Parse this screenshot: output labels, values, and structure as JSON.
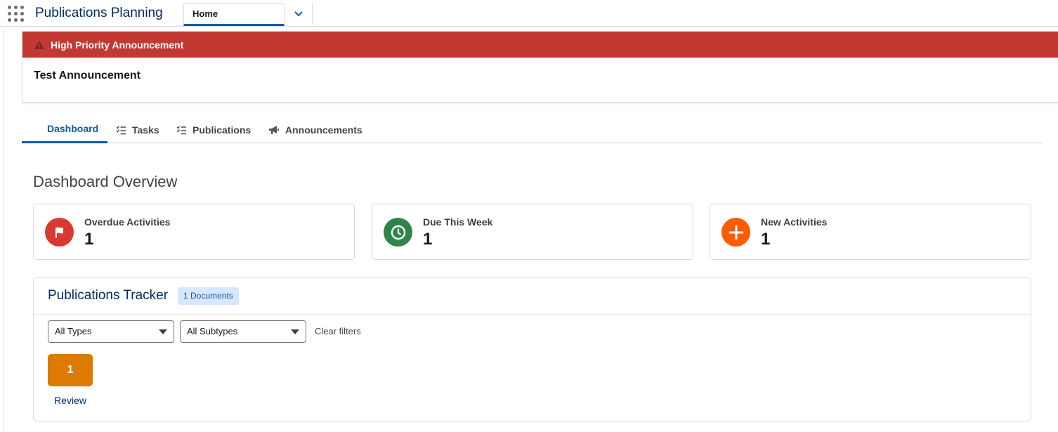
{
  "app": {
    "name": "Publications Planning",
    "nav_tab": "Home"
  },
  "announcement": {
    "title": "High Priority Announcement",
    "body": "Test Announcement",
    "header_color": "#c23934"
  },
  "tabs": [
    {
      "label": "Dashboard",
      "icon": "none",
      "active": true
    },
    {
      "label": "Tasks",
      "icon": "task-list-icon",
      "active": false
    },
    {
      "label": "Publications",
      "icon": "task-list-icon",
      "active": false
    },
    {
      "label": "Announcements",
      "icon": "megaphone-icon",
      "active": false
    }
  ],
  "overview": {
    "title": "Dashboard Overview",
    "cards": [
      {
        "label": "Overdue Activities",
        "value": "1",
        "icon": "flag-icon",
        "color": "#d93930"
      },
      {
        "label": "Due This Week",
        "value": "1",
        "icon": "clock-icon",
        "color": "#2e844a"
      },
      {
        "label": "New Activities",
        "value": "1",
        "icon": "plus-icon",
        "color": "#fe5c03"
      }
    ]
  },
  "tracker": {
    "title": "Publications Tracker",
    "badge": "1 Documents",
    "filters": {
      "type": "All Types",
      "subtype": "All Subtypes",
      "clear": "Clear filters"
    },
    "statuses": [
      {
        "count": "1",
        "label": "Review",
        "color": "#dd7a01"
      }
    ]
  }
}
